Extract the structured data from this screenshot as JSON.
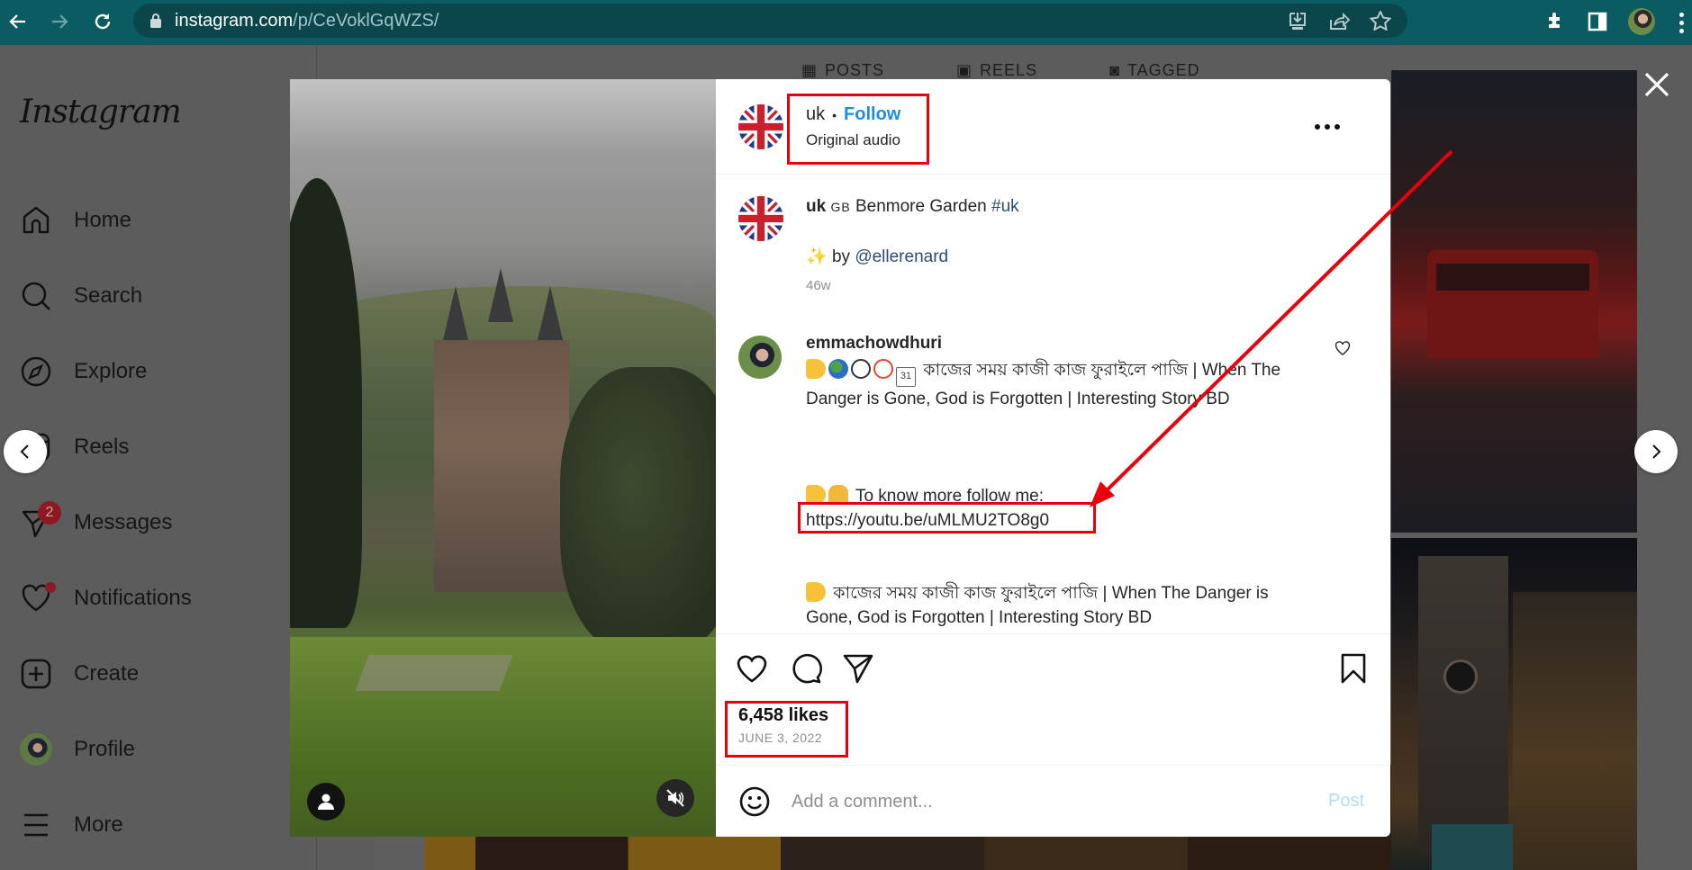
{
  "browser": {
    "url_host": "instagram.com",
    "url_path": "/p/CeVoklGqWZS/",
    "icons": [
      "back-icon",
      "forward-icon",
      "reload-icon",
      "lock-icon",
      "install-app-icon",
      "share-icon",
      "bookmark-star-icon",
      "extensions-icon",
      "side-panel-icon",
      "profile-avatar",
      "menu-kebab-icon"
    ]
  },
  "sidebar": {
    "logo": "Instagram",
    "items": [
      {
        "label": "Home",
        "icon": "home-icon"
      },
      {
        "label": "Search",
        "icon": "search-icon"
      },
      {
        "label": "Explore",
        "icon": "compass-icon"
      },
      {
        "label": "Reels",
        "icon": "reels-icon"
      },
      {
        "label": "Messages",
        "icon": "messenger-icon",
        "badge": "2"
      },
      {
        "label": "Notifications",
        "icon": "heart-icon",
        "dot": true
      },
      {
        "label": "Create",
        "icon": "plus-square-icon"
      },
      {
        "label": "Profile",
        "icon": "avatar"
      },
      {
        "label": "More",
        "icon": "hamburger-icon"
      }
    ]
  },
  "profile_tabs": [
    {
      "label": "POSTS",
      "icon": "grid-icon"
    },
    {
      "label": "REELS",
      "icon": "reels-icon"
    },
    {
      "label": "TAGGED",
      "icon": "tag-icon"
    }
  ],
  "post": {
    "header": {
      "username": "uk",
      "separator": "•",
      "follow_label": "Follow",
      "audio": "Original audio"
    },
    "caption": {
      "username": "uk",
      "flag_text": "GB",
      "text": "Benmore Garden",
      "hashtag": "#uk",
      "by_prefix": "by",
      "credit": "@ellerenard",
      "time": "46w"
    },
    "comment": {
      "username": "emmachowdhuri",
      "line1": "কাজের সময় কাজী কাজ ফুরাইলে পাজি | When The Danger is Gone, God is Forgotten | Interesting Story BD",
      "line2": "To know more follow me:",
      "link": "https://youtu.be/uMLMU2TO8g0",
      "line3": "কাজের সময় কাজী কাজ ফুরাইলে পাজি | When The Danger is Gone, God is Forgotten | Interesting Story BD"
    },
    "likes": "6,458 likes",
    "date": "JUNE 3, 2022",
    "comment_placeholder": "Add a comment...",
    "post_label": "Post"
  },
  "annotations": {
    "color": "#e8000b"
  },
  "colors": {
    "chrome_bg": "#0b5c62",
    "follow_blue": "#1c8ce6",
    "link_blue": "#2c4a75",
    "overlay": "#5c5c5c"
  }
}
